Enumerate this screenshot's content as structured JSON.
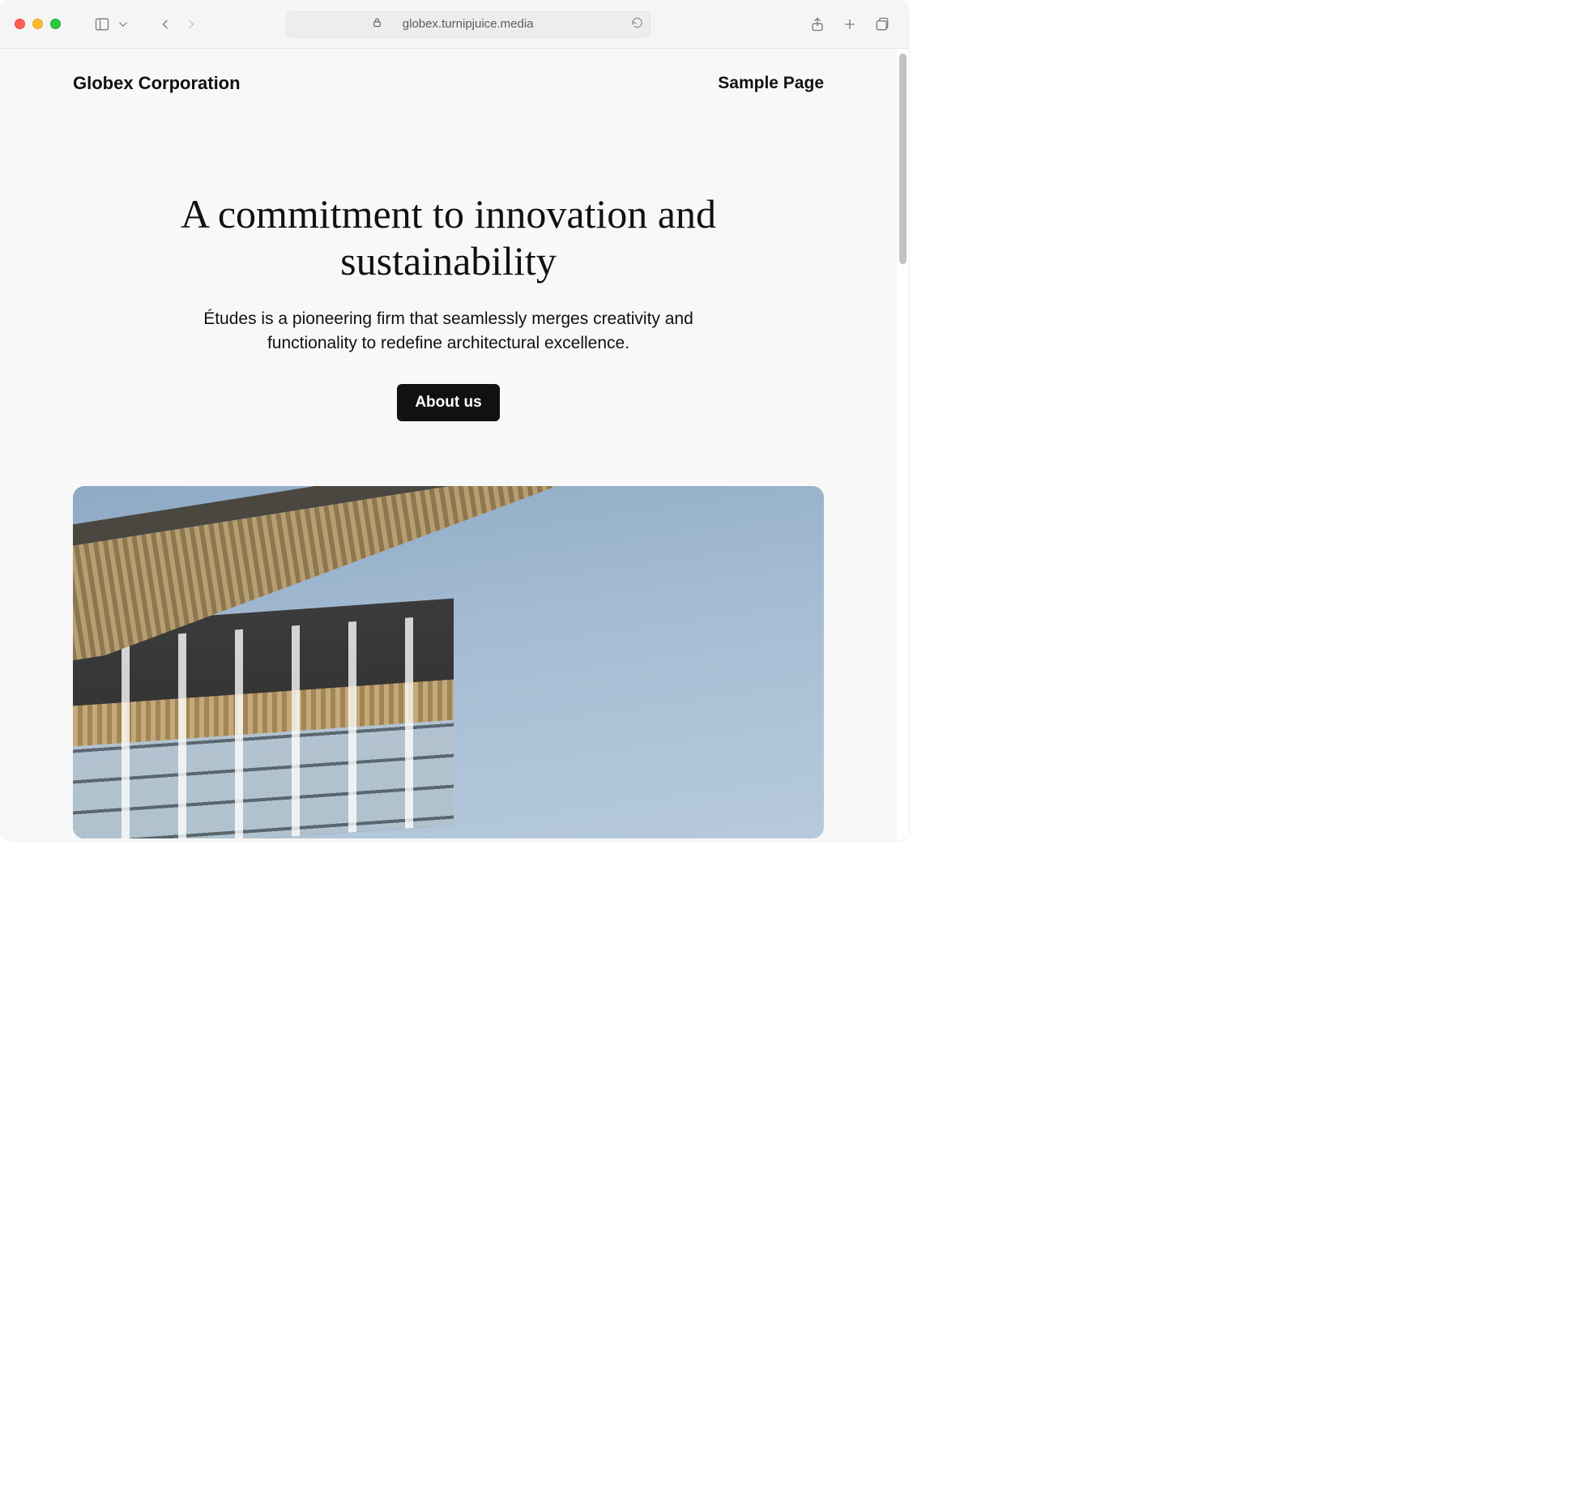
{
  "browser": {
    "url": "globex.turnipjuice.media"
  },
  "site": {
    "title": "Globex Corporation",
    "nav": {
      "sample_page": "Sample Page"
    }
  },
  "hero": {
    "heading": "A commitment to innovation and sustainability",
    "subheading": "Études is a pioneering firm that seamlessly merges creativity and functionality to redefine architectural excellence.",
    "cta_label": "About us"
  }
}
